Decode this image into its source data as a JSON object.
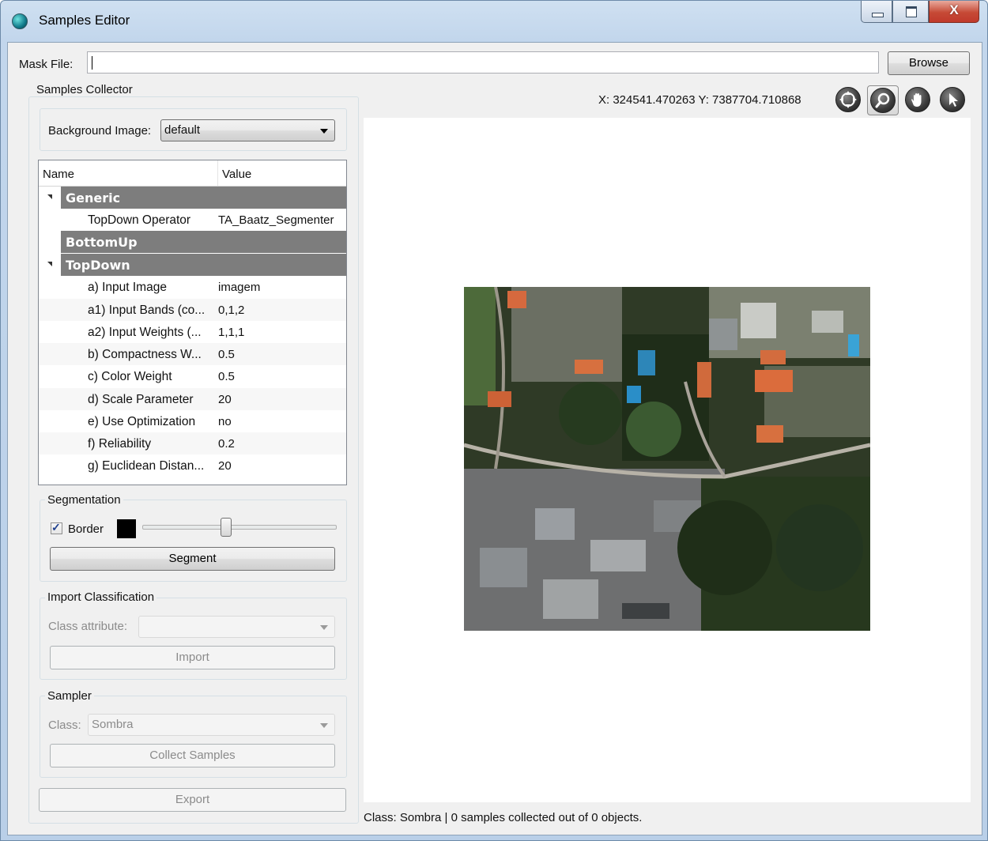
{
  "window": {
    "title": "Samples Editor",
    "controls": {
      "minimize": "minimize",
      "maximize": "maximize",
      "close": "X"
    }
  },
  "mask_file": {
    "label": "Mask File:",
    "value": "",
    "browse_label": "Browse"
  },
  "samples_collector": {
    "title": "Samples Collector",
    "background_image": {
      "label": "Background Image:",
      "selected": "default"
    },
    "properties": {
      "headers": {
        "name": "Name",
        "value": "Value"
      },
      "categories": {
        "generic": "Generic",
        "bottomup": "BottomUp",
        "topdown": "TopDown"
      },
      "generic_rows": [
        {
          "name": "TopDown Operator",
          "value": "TA_Baatz_Segmenter"
        }
      ],
      "topdown_rows": [
        {
          "name": "a) Input Image",
          "value": "imagem"
        },
        {
          "name": "a1) Input Bands (co...",
          "value": "0,1,2"
        },
        {
          "name": "a2) Input Weights (...",
          "value": "1,1,1"
        },
        {
          "name": "b) Compactness W...",
          "value": "0.5"
        },
        {
          "name": "c) Color Weight",
          "value": "0.5"
        },
        {
          "name": "d) Scale Parameter",
          "value": "20"
        },
        {
          "name": "e) Use Optimization",
          "value": "no"
        },
        {
          "name": "f) Reliability",
          "value": "0.2"
        },
        {
          "name": "g) Euclidean Distan...",
          "value": "20"
        }
      ]
    }
  },
  "segmentation": {
    "title": "Segmentation",
    "border_label": "Border",
    "border_checked": true,
    "border_color": "#000000",
    "slider_level": 0.43,
    "segment_label": "Segment"
  },
  "import_classification": {
    "title": "Import Classification",
    "class_attribute_label": "Class attribute:",
    "class_attribute_value": "",
    "import_label": "Import"
  },
  "sampler": {
    "title": "Sampler",
    "class_label": "Class:",
    "class_value": "Sombra",
    "collect_label": "Collect Samples"
  },
  "export_label": "Export",
  "map": {
    "coordinates": "X: 324541.470263  Y: 7387704.710868",
    "tools": [
      "extent-icon",
      "zoom-icon",
      "pan-icon",
      "select-icon"
    ],
    "active_tool": "zoom-icon"
  },
  "status_text": "Class: Sombra | 0 samples collected out of 0 objects."
}
